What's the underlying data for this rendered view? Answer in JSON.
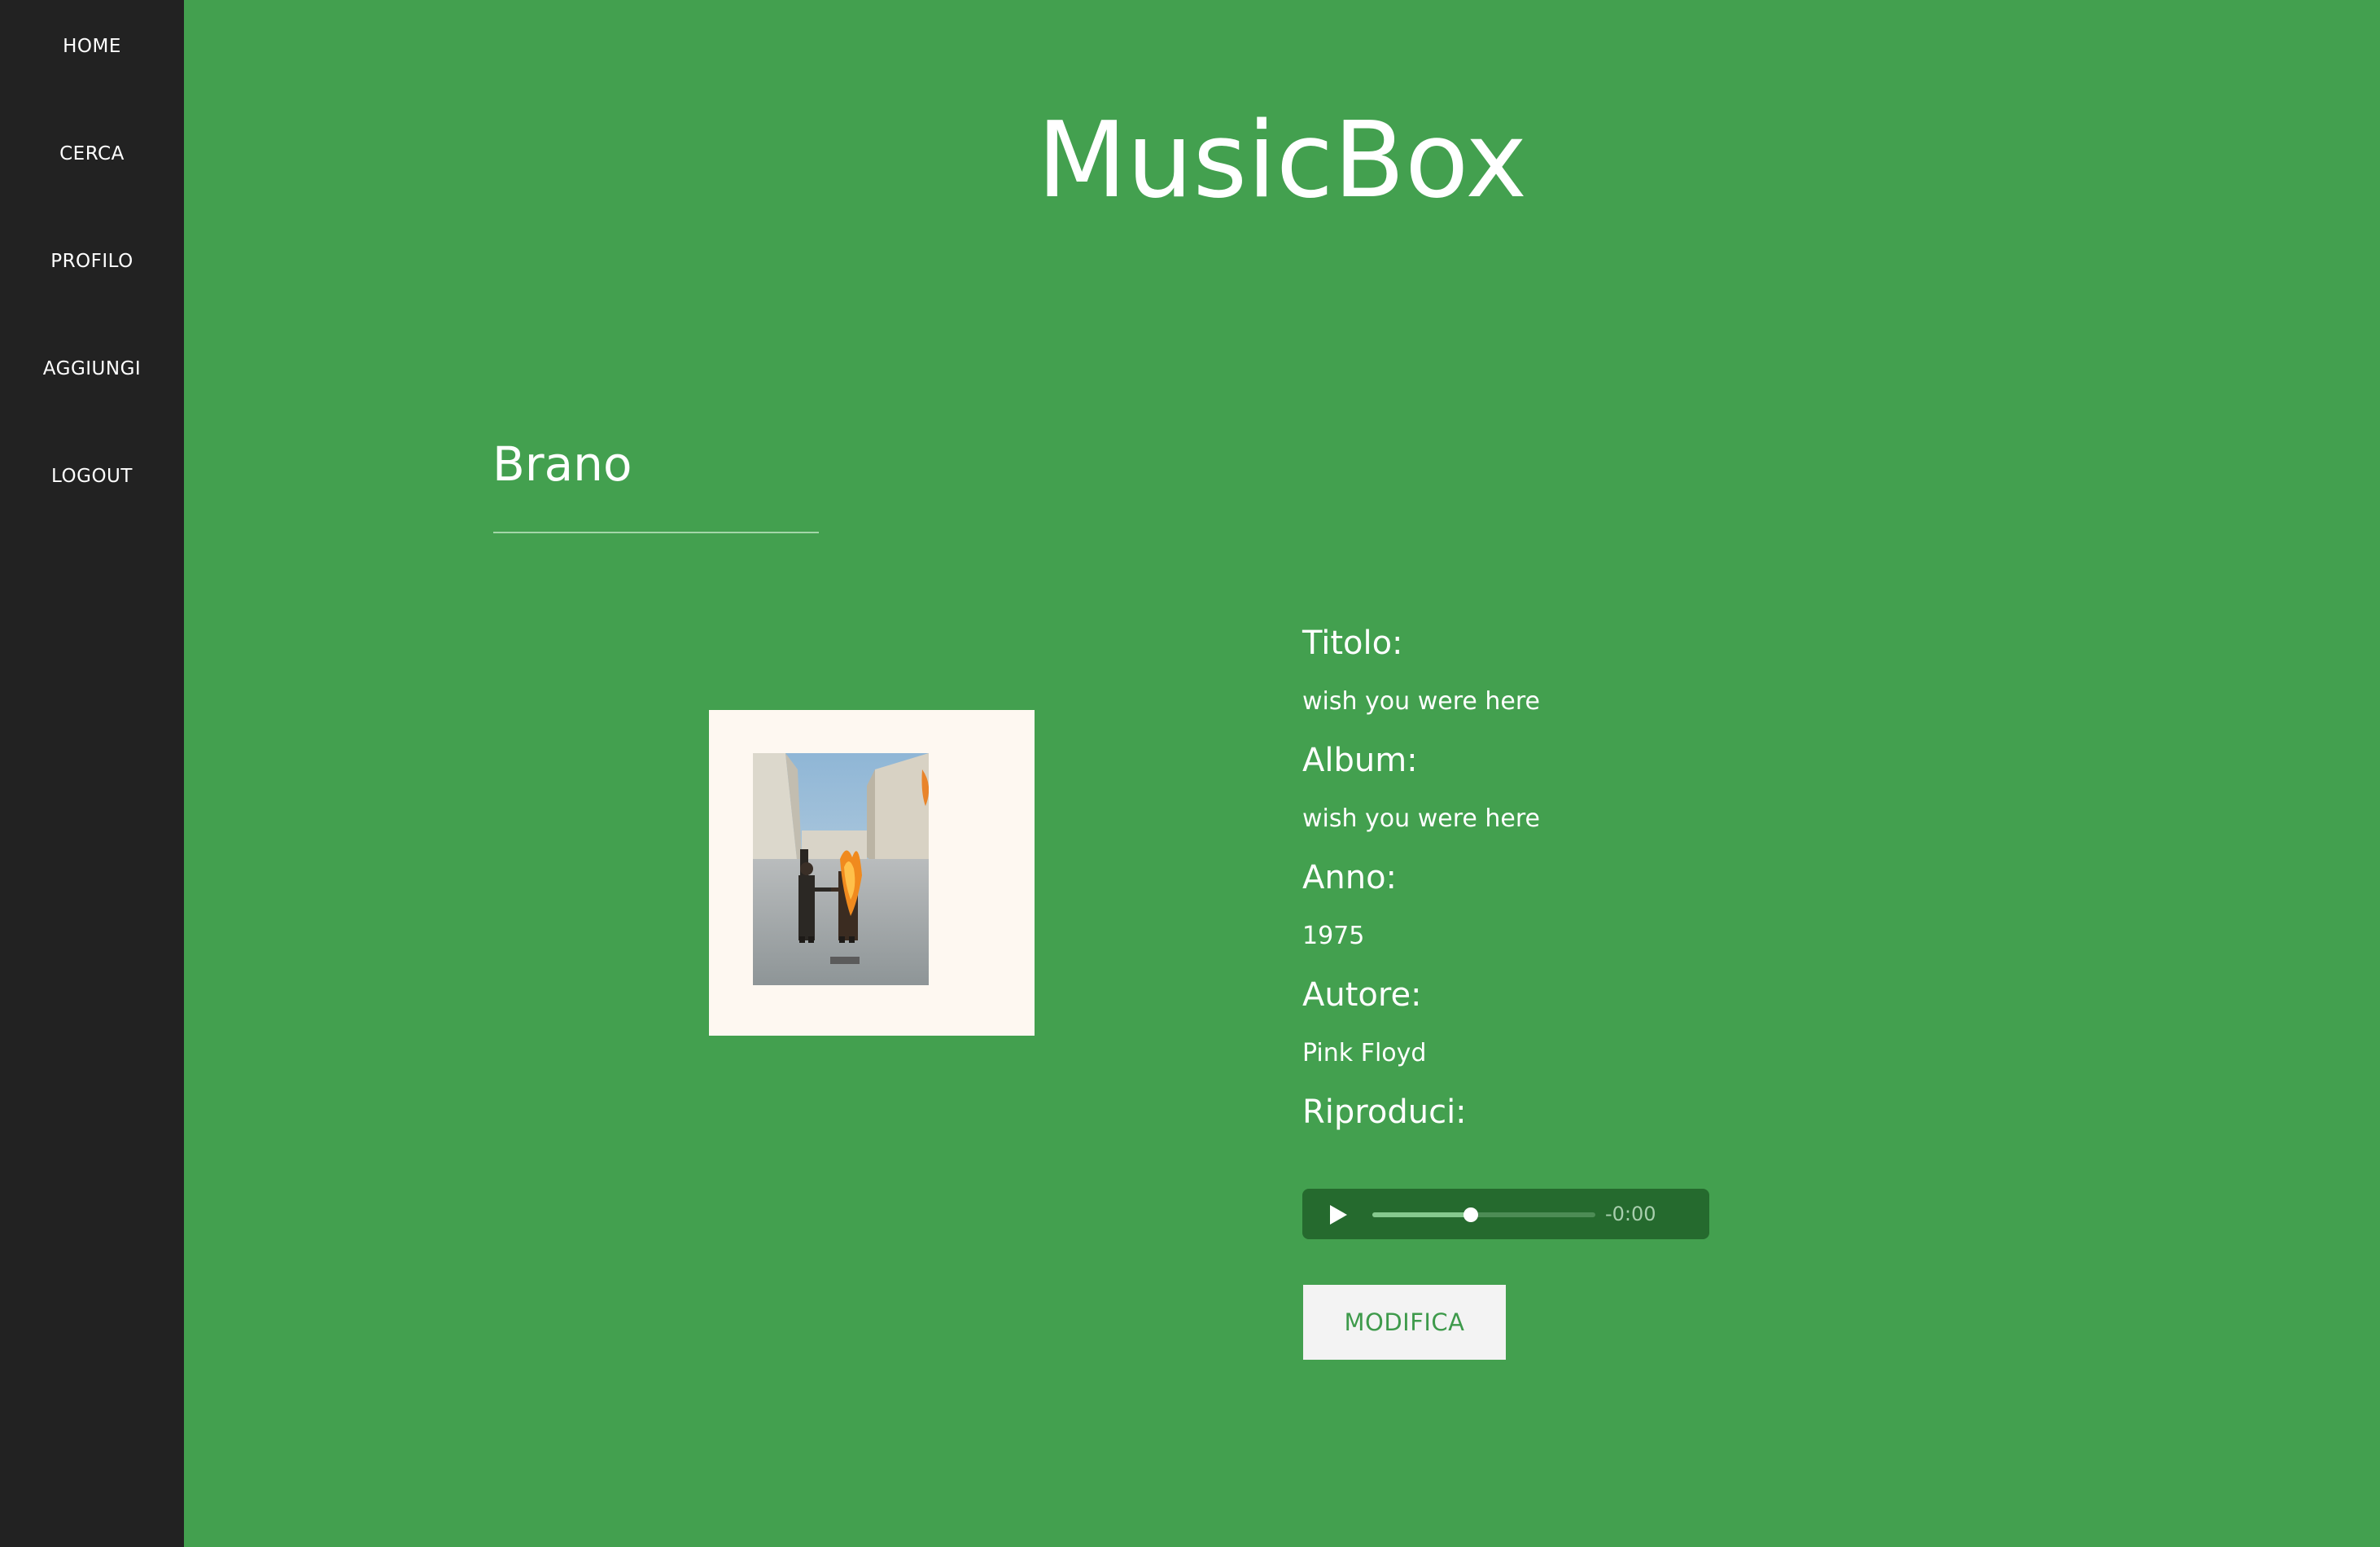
{
  "sidebar": {
    "items": [
      {
        "label": "HOME"
      },
      {
        "label": "CERCA"
      },
      {
        "label": "PROFILO"
      },
      {
        "label": "AGGIUNGI"
      },
      {
        "label": "LOGOUT"
      }
    ]
  },
  "header": {
    "title": "MusicBox"
  },
  "main": {
    "section_title": "Brano",
    "cover": {
      "icon": "album-cover-image"
    },
    "details": {
      "titolo_label": "Titolo:",
      "titolo_value": "wish you were here",
      "album_label": "Album:",
      "album_value": "wish you were here",
      "anno_label": "Anno:",
      "anno_value": "1975",
      "autore_label": "Autore:",
      "autore_value": "Pink Floyd",
      "riproduci_label": "Riproduci:"
    },
    "player": {
      "play_icon": "play-icon",
      "progress": 0.44,
      "time": "-0:00"
    },
    "edit_button_label": "MODIFICA"
  },
  "colors": {
    "background": "#43a04f",
    "sidebar": "#222222",
    "player_bg": "#256a2e",
    "button_bg": "#f3f3f3",
    "button_text": "#3e9a4b",
    "cover_frame": "#fef8f1"
  }
}
